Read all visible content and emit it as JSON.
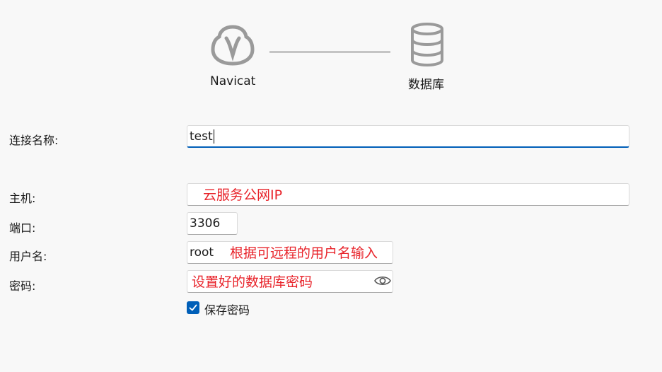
{
  "header": {
    "source_label": "Navicat",
    "target_label": "数据库"
  },
  "form": {
    "connection_name": {
      "label": "连接名称:",
      "value": "test"
    },
    "host": {
      "label": "主机:",
      "value": "",
      "annotation": "云服务公网IP"
    },
    "port": {
      "label": "端口:",
      "value": "3306"
    },
    "username": {
      "label": "用户名:",
      "value": "root",
      "annotation": "根据可远程的用户名输入"
    },
    "password": {
      "label": "密码:",
      "value": "",
      "annotation": "设置好的数据库密码",
      "toggle_icon": "eye-icon"
    },
    "save_password": {
      "label": "保存密码",
      "checked": true
    }
  },
  "colors": {
    "accent": "#005fb8",
    "annotation": "#e8232a",
    "icon_gray": "#9a9a9a"
  }
}
